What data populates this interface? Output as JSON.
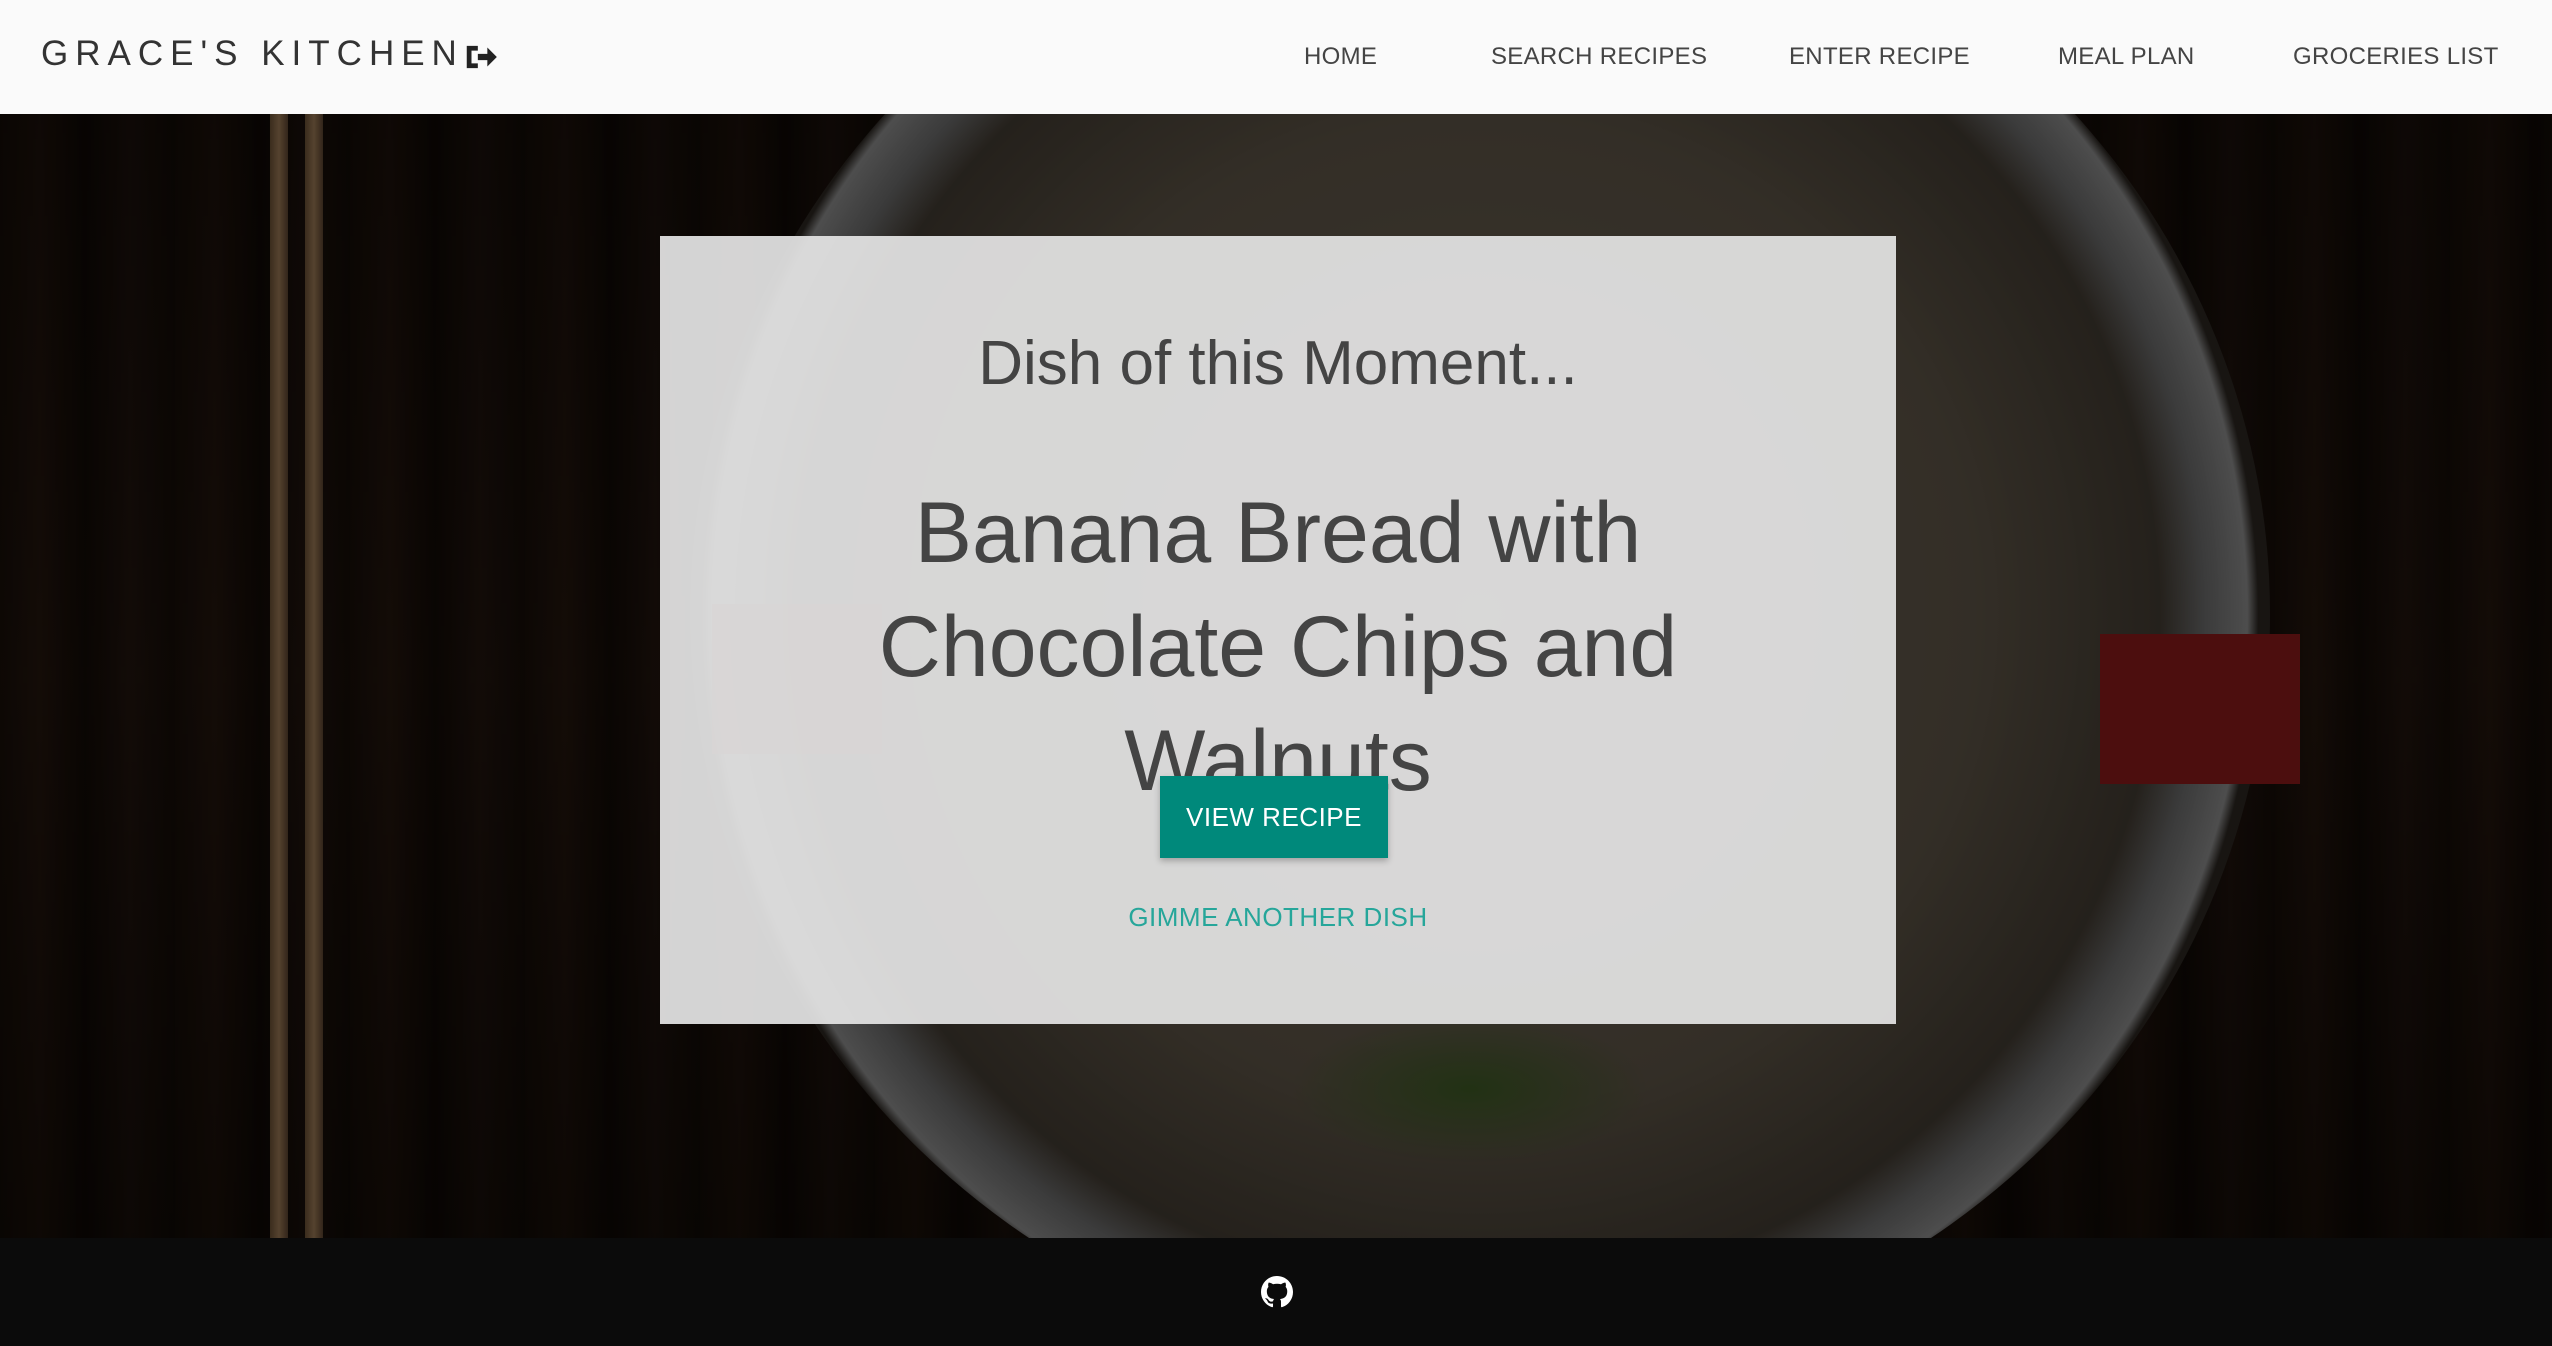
{
  "header": {
    "brand": "GRACE'S KITCHEN",
    "logout_icon": "sign-out-icon",
    "nav": [
      {
        "label": "HOME"
      },
      {
        "label": "SEARCH RECIPES"
      },
      {
        "label": "ENTER RECIPE"
      },
      {
        "label": "MEAL PLAN"
      },
      {
        "label": "GROCERIES LIST"
      }
    ]
  },
  "card": {
    "subtitle": "Dish of this Moment...",
    "dish_title": "Banana Bread with Chocolate Chips and Walnuts",
    "view_button": "VIEW RECIPE",
    "another_link": "GIMME ANOTHER DISH"
  },
  "footer": {
    "github_icon": "github-icon"
  },
  "colors": {
    "accent": "#00897b",
    "link": "#26a69a",
    "navbar_bg": "#fafafa",
    "footer_bg": "#0b0b0b",
    "text_dark": "#444444"
  }
}
